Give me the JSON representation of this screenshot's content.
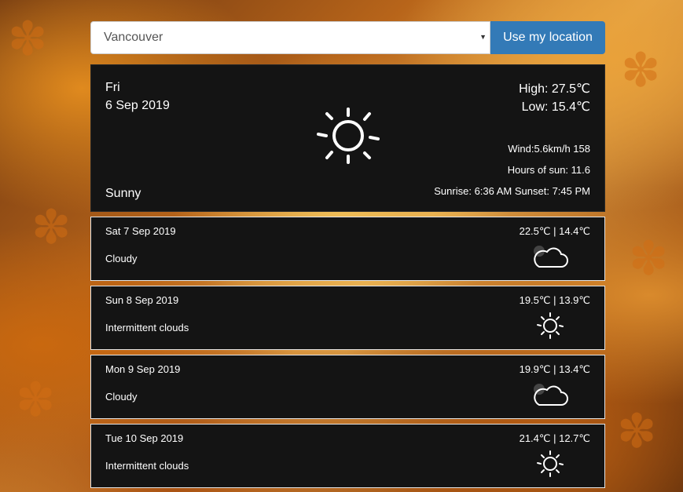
{
  "search": {
    "selected_city": "Vancouver",
    "location_button_label": "Use my location"
  },
  "today": {
    "day_of_week": "Fri",
    "date": "6 Sep 2019",
    "high": "High: 27.5℃",
    "low": "Low: 15.4℃",
    "wind": "Wind:5.6km/h 158",
    "hours_of_sun": "Hours of sun: 11.6",
    "sunrise_sunset": "Sunrise: 6:36 AM Sunset: 7:45 PM",
    "condition": "Sunny",
    "icon": "sun-icon"
  },
  "forecast": [
    {
      "date": "Sat 7 Sep 2019",
      "temps": "22.5℃ | 14.4℃",
      "condition": "Cloudy",
      "icon": "cloud-icon"
    },
    {
      "date": "Sun 8 Sep 2019",
      "temps": "19.5℃ | 13.9℃",
      "condition": "Intermittent clouds",
      "icon": "sun-icon"
    },
    {
      "date": "Mon 9 Sep 2019",
      "temps": "19.9℃ | 13.4℃",
      "condition": "Cloudy",
      "icon": "cloud-icon"
    },
    {
      "date": "Tue 10 Sep 2019",
      "temps": "21.4℃ | 12.7℃",
      "condition": "Intermittent clouds",
      "icon": "sun-icon"
    }
  ],
  "colors": {
    "button": "#337ab7",
    "panel": "#141414"
  }
}
